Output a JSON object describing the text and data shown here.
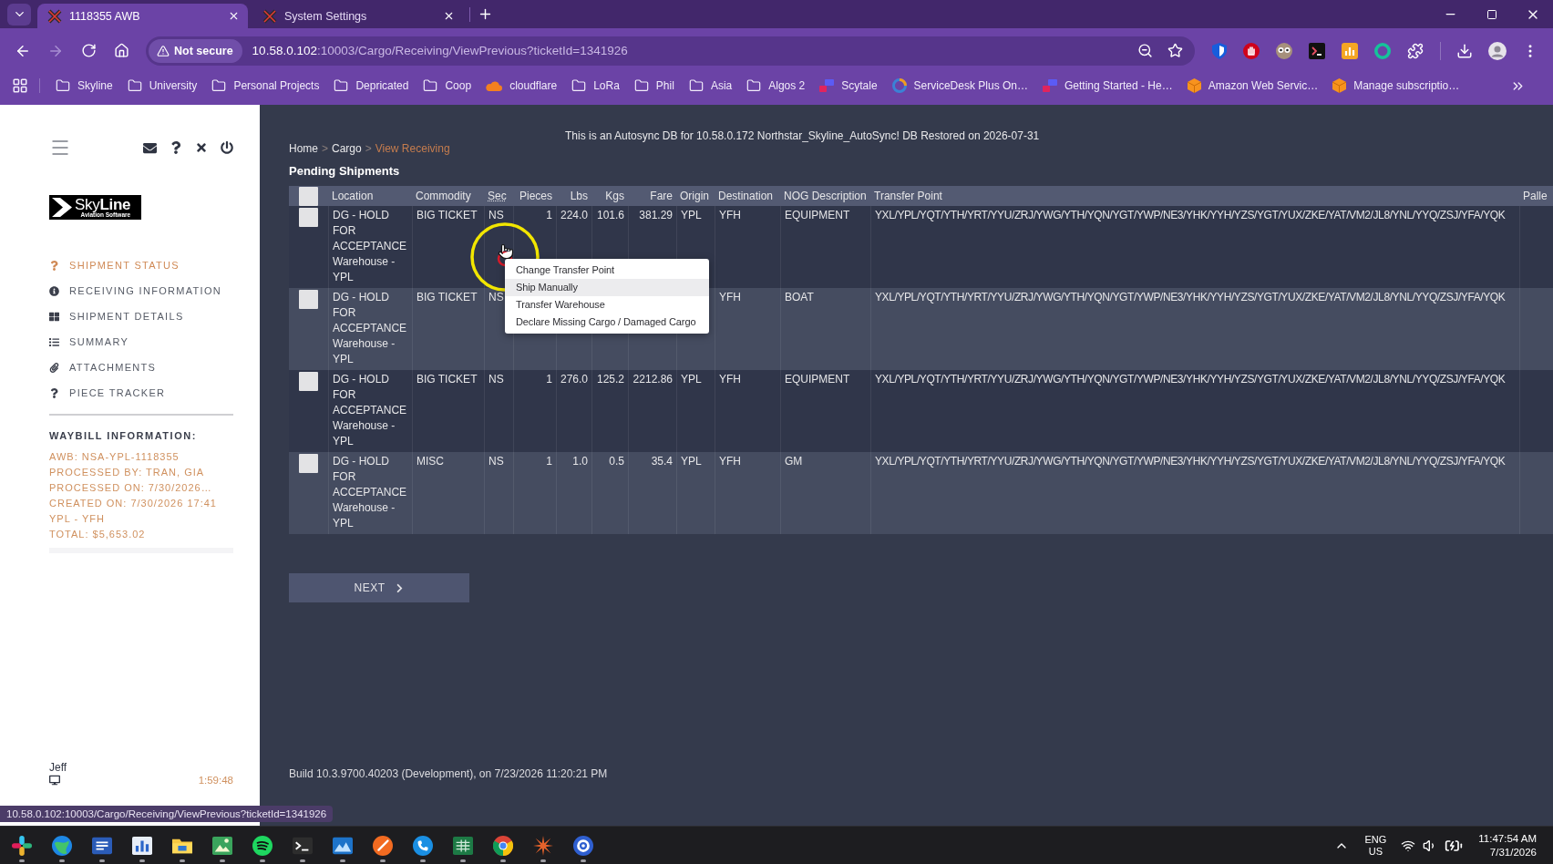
{
  "browser": {
    "tabs": [
      {
        "title": "1118355 AWB",
        "selected": true
      },
      {
        "title": "System Settings",
        "selected": false
      }
    ],
    "forward_disabled": true,
    "address": {
      "security": "Not secure",
      "host": "10.58.0.102",
      "path": ":10003/Cargo/Receiving/ViewPrevious?ticketId=1341926"
    },
    "bookmarks": [
      {
        "label": "Skyline",
        "kind": "folder"
      },
      {
        "label": "University",
        "kind": "folder"
      },
      {
        "label": "Personal Projects",
        "kind": "folder"
      },
      {
        "label": "Depricated",
        "kind": "folder"
      },
      {
        "label": "Coop",
        "kind": "folder"
      },
      {
        "label": "cloudflare",
        "kind": "cloud"
      },
      {
        "label": "LoRa",
        "kind": "folder"
      },
      {
        "label": "Phil",
        "kind": "folder"
      },
      {
        "label": "Asia",
        "kind": "folder"
      },
      {
        "label": "Algos 2",
        "kind": "folder"
      },
      {
        "label": "Scytale",
        "kind": "blocks"
      },
      {
        "label": "ServiceDesk Plus On…",
        "kind": "swirl"
      },
      {
        "label": "Getting Started - He…",
        "kind": "blocks"
      },
      {
        "label": "Amazon Web Servic…",
        "kind": "cube"
      },
      {
        "label": "Manage subscriptio…",
        "kind": "cube"
      }
    ],
    "status_url": "10.58.0.102:10003/Cargo/Receiving/ViewPrevious?ticketId=1341926"
  },
  "sidebar": {
    "logo": {
      "name": "Sky**Line**",
      "tagline": "Aviation Software"
    },
    "nav": [
      {
        "label": "SHIPMENT STATUS",
        "selected": true
      },
      {
        "label": "RECEIVING INFORMATION",
        "selected": false
      },
      {
        "label": "SHIPMENT DETAILS",
        "selected": false
      },
      {
        "label": "SUMMARY",
        "selected": false
      },
      {
        "label": "ATTACHMENTS",
        "selected": false
      },
      {
        "label": "PIECE TRACKER",
        "selected": false
      }
    ],
    "waybill": {
      "title": "WAYBILL INFORMATION:",
      "lines": [
        "AWB: NSA-YPL-1118355",
        "PROCESSED BY: TRAN, GIA",
        "PROCESSED ON: 7/30/2026…",
        "CREATED ON: 7/30/2026 17:41",
        "YPL - YFH",
        "TOTAL: $5,653.02"
      ]
    },
    "user": "Jeff",
    "timer": "1:59:48"
  },
  "page": {
    "notice": "This is an Autosync DB for 10.58.0.172 Northstar_Skyline_AutoSync! DB Restored on 2026-07-31",
    "breadcrumb": {
      "separator": ">",
      "items": [
        {
          "label": "Home",
          "selected": false
        },
        {
          "label": "Cargo",
          "selected": false
        },
        {
          "label": "View Receiving",
          "selected": true
        }
      ]
    },
    "section_title": "Pending Shipments",
    "table": {
      "select_all_checked": false,
      "columns": [
        {
          "label": "Location",
          "kind": "text"
        },
        {
          "label": "Commodity",
          "kind": "text"
        },
        {
          "label": "Sec",
          "kind": "abbr"
        },
        {
          "label": "Pieces",
          "kind": "number"
        },
        {
          "label": "Lbs",
          "kind": "number"
        },
        {
          "label": "Kgs",
          "kind": "number"
        },
        {
          "label": "Fare",
          "kind": "number"
        },
        {
          "label": "Origin",
          "kind": "text"
        },
        {
          "label": "Destination",
          "kind": "text"
        },
        {
          "label": "NOG Description",
          "kind": "text"
        },
        {
          "label": "Transfer Point",
          "kind": "route"
        },
        {
          "label": "Palle",
          "kind": "text"
        }
      ],
      "rows": [
        {
          "checked": false,
          "cells": [
            "DG - HOLD FOR ACCEPTANCE Warehouse - YPL",
            "BIG TICKET",
            "NS",
            "1",
            "224.0",
            "101.6",
            "381.29",
            "YPL",
            "YFH",
            "EQUIPMENT",
            "YXL/YPL/YQT/YTH/YRT/YYU/ZRJ/YWG/YTH/YQN/YGT/YWP/NE3/YHK/YYH/YZS/YGT/YUX/ZKE/YAT/VM2/JL8/YNL/YYQ/ZSJ/YFA/YQK"
          ]
        },
        {
          "checked": false,
          "cells": [
            "DG - HOLD FOR ACCEPTANCE Warehouse - YPL",
            "BIG TICKET",
            "NS",
            null,
            null,
            null,
            null,
            null,
            "YFH",
            "BOAT",
            "YXL/YPL/YQT/YTH/YRT/YYU/ZRJ/YWG/YTH/YQN/YGT/YWP/NE3/YHK/YYH/YZS/YGT/YUX/ZKE/YAT/VM2/JL8/YNL/YYQ/ZSJ/YFA/YQK"
          ]
        },
        {
          "checked": false,
          "cells": [
            "DG - HOLD FOR ACCEPTANCE Warehouse - YPL",
            "BIG TICKET",
            "NS",
            "1",
            "276.0",
            "125.2",
            "2212.86",
            "YPL",
            "YFH",
            "EQUIPMENT",
            "YXL/YPL/YQT/YTH/YRT/YYU/ZRJ/YWG/YTH/YQN/YGT/YWP/NE3/YHK/YYH/YZS/YGT/YUX/ZKE/YAT/VM2/JL8/YNL/YYQ/ZSJ/YFA/YQK"
          ]
        },
        {
          "checked": false,
          "cells": [
            "DG - HOLD FOR ACCEPTANCE Warehouse - YPL",
            "MISC",
            "NS",
            "1",
            "1.0",
            "0.5",
            "35.4",
            "YPL",
            "YFH",
            "GM",
            "YXL/YPL/YQT/YTH/YRT/YYU/ZRJ/YWG/YTH/YQN/YGT/YWP/NE3/YHK/YYH/YZS/YGT/YUX/ZKE/YAT/VM2/JL8/YNL/YYQ/ZSJ/YFA/YQK"
          ]
        }
      ]
    },
    "context_menu": {
      "items": [
        {
          "label": "Change Transfer Point",
          "selected": false
        },
        {
          "label": "Ship Manually",
          "selected": true
        },
        {
          "label": "Transfer Warehouse",
          "selected": false
        },
        {
          "label": "Declare Missing Cargo / Damaged Cargo",
          "selected": false
        }
      ]
    },
    "next_button": "NEXT",
    "build_info": "Build 10.3.9700.40203 (Development), on 7/23/2026 11:20:21 PM"
  },
  "taskbar": {
    "apps": [
      {
        "running": true
      },
      {
        "running": true
      },
      {
        "running": true
      },
      {
        "running": true
      },
      {
        "running": true
      },
      {
        "running": true
      },
      {
        "running": true
      },
      {
        "running": true
      },
      {
        "running": true
      },
      {
        "running": true
      },
      {
        "running": true
      },
      {
        "running": true
      },
      {
        "running": true
      },
      {
        "running": true
      },
      {
        "running": true
      }
    ],
    "language": "ENG",
    "region": "US",
    "time": "11:47:54 AM",
    "date": "7/31/2026"
  }
}
